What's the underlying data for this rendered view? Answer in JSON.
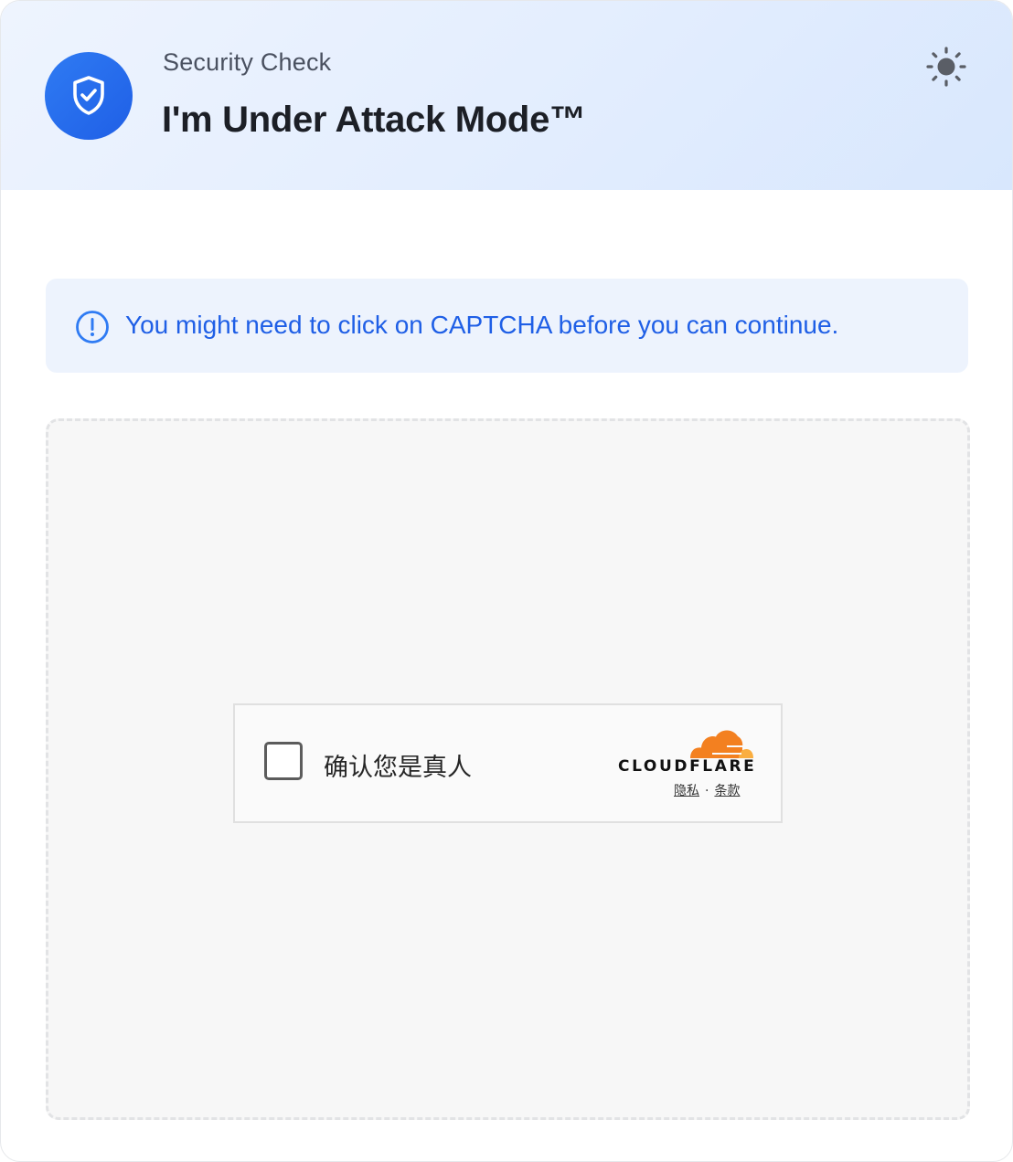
{
  "header": {
    "subtitle": "Security Check",
    "title": "I'm Under Attack Mode™",
    "shield_icon": "shield-check-icon",
    "theme_icon": "sun-icon",
    "accent_color": "#1f5fe6"
  },
  "notice": {
    "icon": "info-circle-icon",
    "text": "You might need to click on CAPTCHA before you can continue."
  },
  "captcha": {
    "checkbox_label": "确认您是真人",
    "brand": "CLOUDFLARE",
    "brand_color": "#f48120",
    "privacy_link": "隐私",
    "separator": "·",
    "terms_link": "条款"
  }
}
